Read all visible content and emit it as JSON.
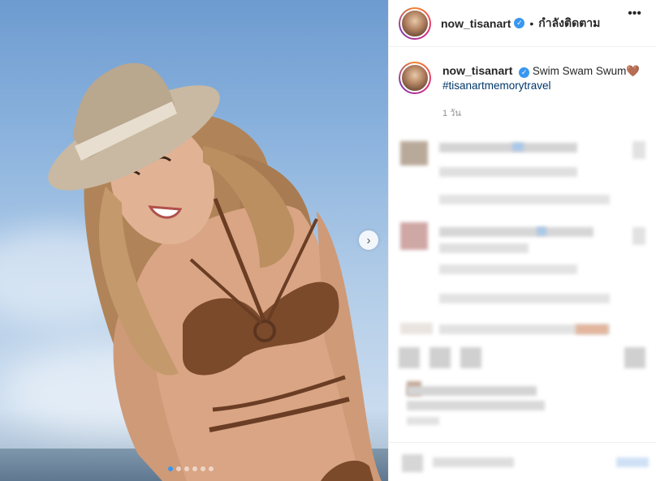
{
  "post": {
    "username": "now_tisanart",
    "verified_glyph": "✓",
    "separator": "•",
    "follow_status": "กำลังติดตาม",
    "more_glyph": "•••",
    "caption_text": "Swim Swam Swum",
    "caption_emoji": "🤎",
    "hashtag": "#tisanartmemorytravel",
    "time_ago": "1 วัน"
  },
  "carousel": {
    "next_glyph": "›",
    "slide_count": 6,
    "active_index": 0
  },
  "icons": {
    "verified": "verified-badge-icon",
    "next": "chevron-right-icon",
    "more": "more-options-icon"
  },
  "colors": {
    "accent": "#3897f0",
    "hashtag": "#00376b",
    "muted": "#8e8e8e",
    "text": "#262626"
  }
}
